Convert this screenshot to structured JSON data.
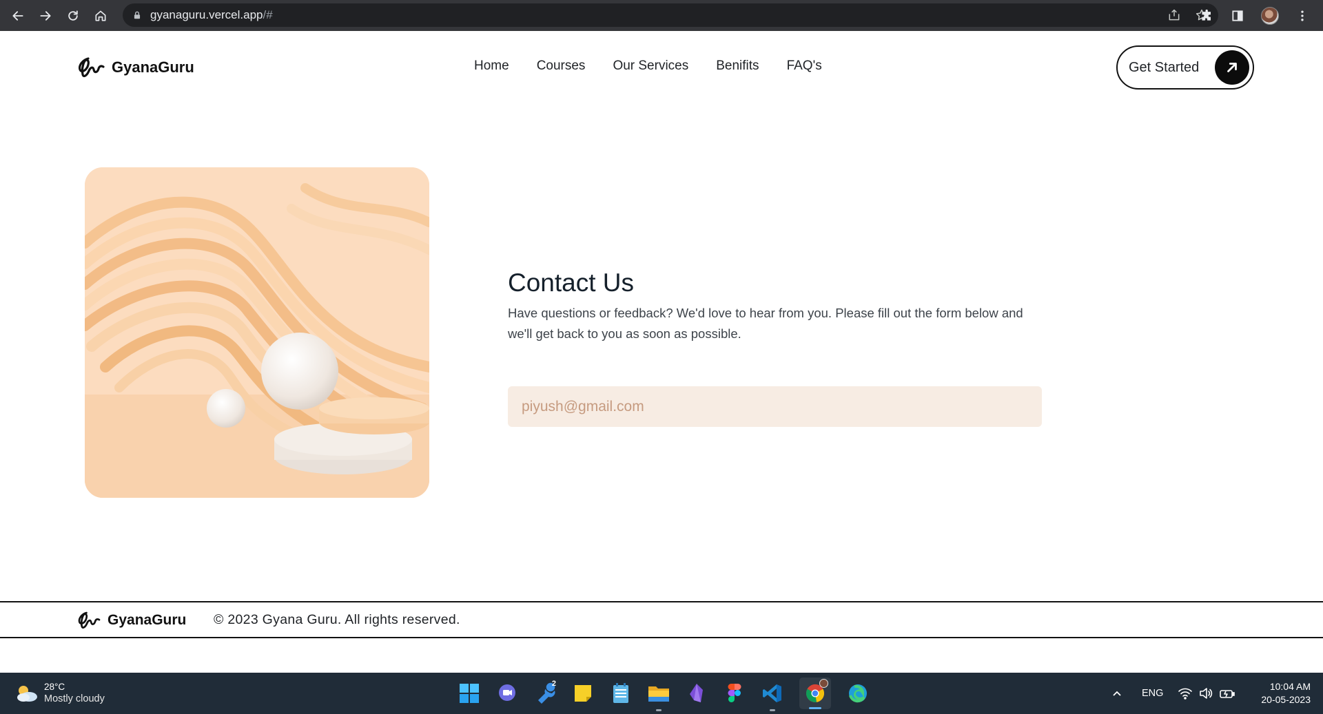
{
  "browser": {
    "url_host": "gyanaguru.vercel.app",
    "url_rest": "/#",
    "icons": [
      "back-arrow-icon",
      "forward-arrow-icon",
      "reload-icon",
      "home-icon",
      "lock-icon",
      "share-icon",
      "star-icon",
      "extensions-icon",
      "sidepanel-icon",
      "profile-avatar",
      "kebab-menu-icon"
    ]
  },
  "header": {
    "brand": "GyanaGuru",
    "nav": [
      "Home",
      "Courses",
      "Our Services",
      "Benifits",
      "FAQ's"
    ],
    "cta_label": "Get Started"
  },
  "contact": {
    "title": "Contact Us",
    "description": "Have questions or feedback? We'd love to hear from you. Please fill out the form below and we'll get back to you as soon as possible.",
    "email_value": "piyush@gmail.com"
  },
  "footer": {
    "brand": "GyanaGuru",
    "copyright": "© 2023 Gyana Guru. All rights reserved."
  },
  "taskbar": {
    "temperature": "28°C",
    "condition": "Mostly cloudy",
    "badge_count": "2",
    "language": "ENG",
    "time": "10:04 AM",
    "date": "20-05-2023",
    "colors": {
      "bg": "#202c38",
      "accent": "#5fb2f2"
    }
  }
}
